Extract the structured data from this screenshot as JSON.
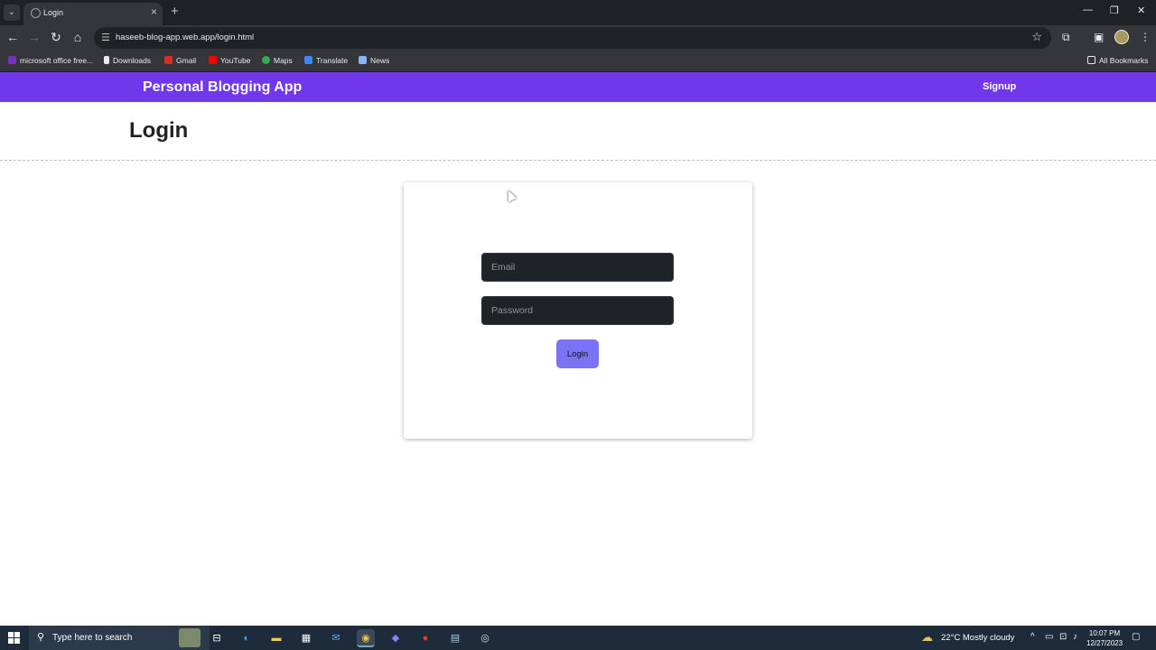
{
  "browser": {
    "tab": {
      "title": "Login"
    },
    "address": {
      "url": "haseeb-blog-app.web.app/login.html"
    },
    "bookmarks": [
      {
        "label": "microsoft office free...",
        "color": "#7b2fbe"
      },
      {
        "label": "Downloads",
        "color": "#e8eaed"
      },
      {
        "label": "Gmail",
        "color": "#d93025"
      },
      {
        "label": "YouTube",
        "color": "#ff0000"
      },
      {
        "label": "Maps",
        "color": "#34a853"
      },
      {
        "label": "Translate",
        "color": "#4285f4"
      },
      {
        "label": "News",
        "color": "#8ab4f8"
      }
    ],
    "all_bookmarks": "All Bookmarks"
  },
  "navbar": {
    "brand": "Personal Blogging App",
    "signup": "Signup",
    "bg_color": "#7137ea"
  },
  "page": {
    "title": "Login"
  },
  "login_form": {
    "email_placeholder": "Email",
    "password_placeholder": "Password",
    "login_label": "Login",
    "button_color": "#7a73f5"
  },
  "taskbar": {
    "search_placeholder": "Type here to search",
    "weather_temp": "22°C",
    "weather_desc": "Mostly cloudy",
    "time": "10:07 PM",
    "date": "12/27/2023"
  }
}
